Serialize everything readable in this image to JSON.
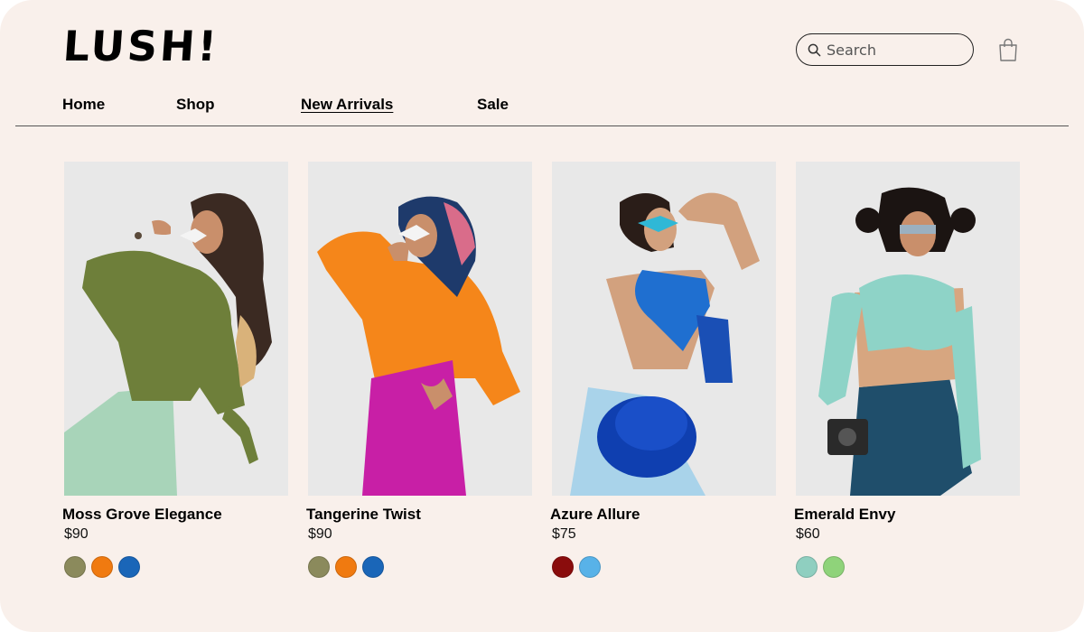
{
  "brand": {
    "logo_text": "LUSH!"
  },
  "search": {
    "placeholder": "Search",
    "value": ""
  },
  "icons": {
    "search": "search-icon",
    "cart": "shopping-bag-icon"
  },
  "nav": {
    "items": [
      {
        "label": "Home",
        "active": false
      },
      {
        "label": "Shop",
        "active": false
      },
      {
        "label": "New Arrivals",
        "active": true
      },
      {
        "label": "Sale",
        "active": false
      }
    ]
  },
  "products": [
    {
      "name": "Moss Grove Elegance",
      "price": "$90",
      "swatches": [
        "#8b8a5c",
        "#f07a10",
        "#1a66b8"
      ],
      "palette": {
        "top": "#6e7f3a",
        "bottom": "#a8d4b9",
        "skin": "#c98f6b",
        "hair": "#3b2a22"
      }
    },
    {
      "name": "Tangerine Twist",
      "price": "$90",
      "swatches": [
        "#8b8a5c",
        "#f07a10",
        "#1a66b8"
      ],
      "palette": {
        "top": "#f5861a",
        "bottom": "#c81fa6",
        "skin": "#c98f6b",
        "hair": "#2a1d18"
      }
    },
    {
      "name": "Azure Allure",
      "price": "$75",
      "swatches": [
        "#8a0c0c",
        "#58b2e8"
      ],
      "palette": {
        "top": "#1f6fd0",
        "bottom": "#a9d3ea",
        "skin": "#d2a17e",
        "hair": "#2a1d18"
      }
    },
    {
      "name": "Emerald Envy",
      "price": "$60",
      "swatches": [
        "#8fcfc0",
        "#8fd37a"
      ],
      "palette": {
        "top": "#8ed3c7",
        "bottom": "#1f4e6b",
        "skin": "#c98f6b",
        "hair": "#1b1412"
      }
    }
  ]
}
